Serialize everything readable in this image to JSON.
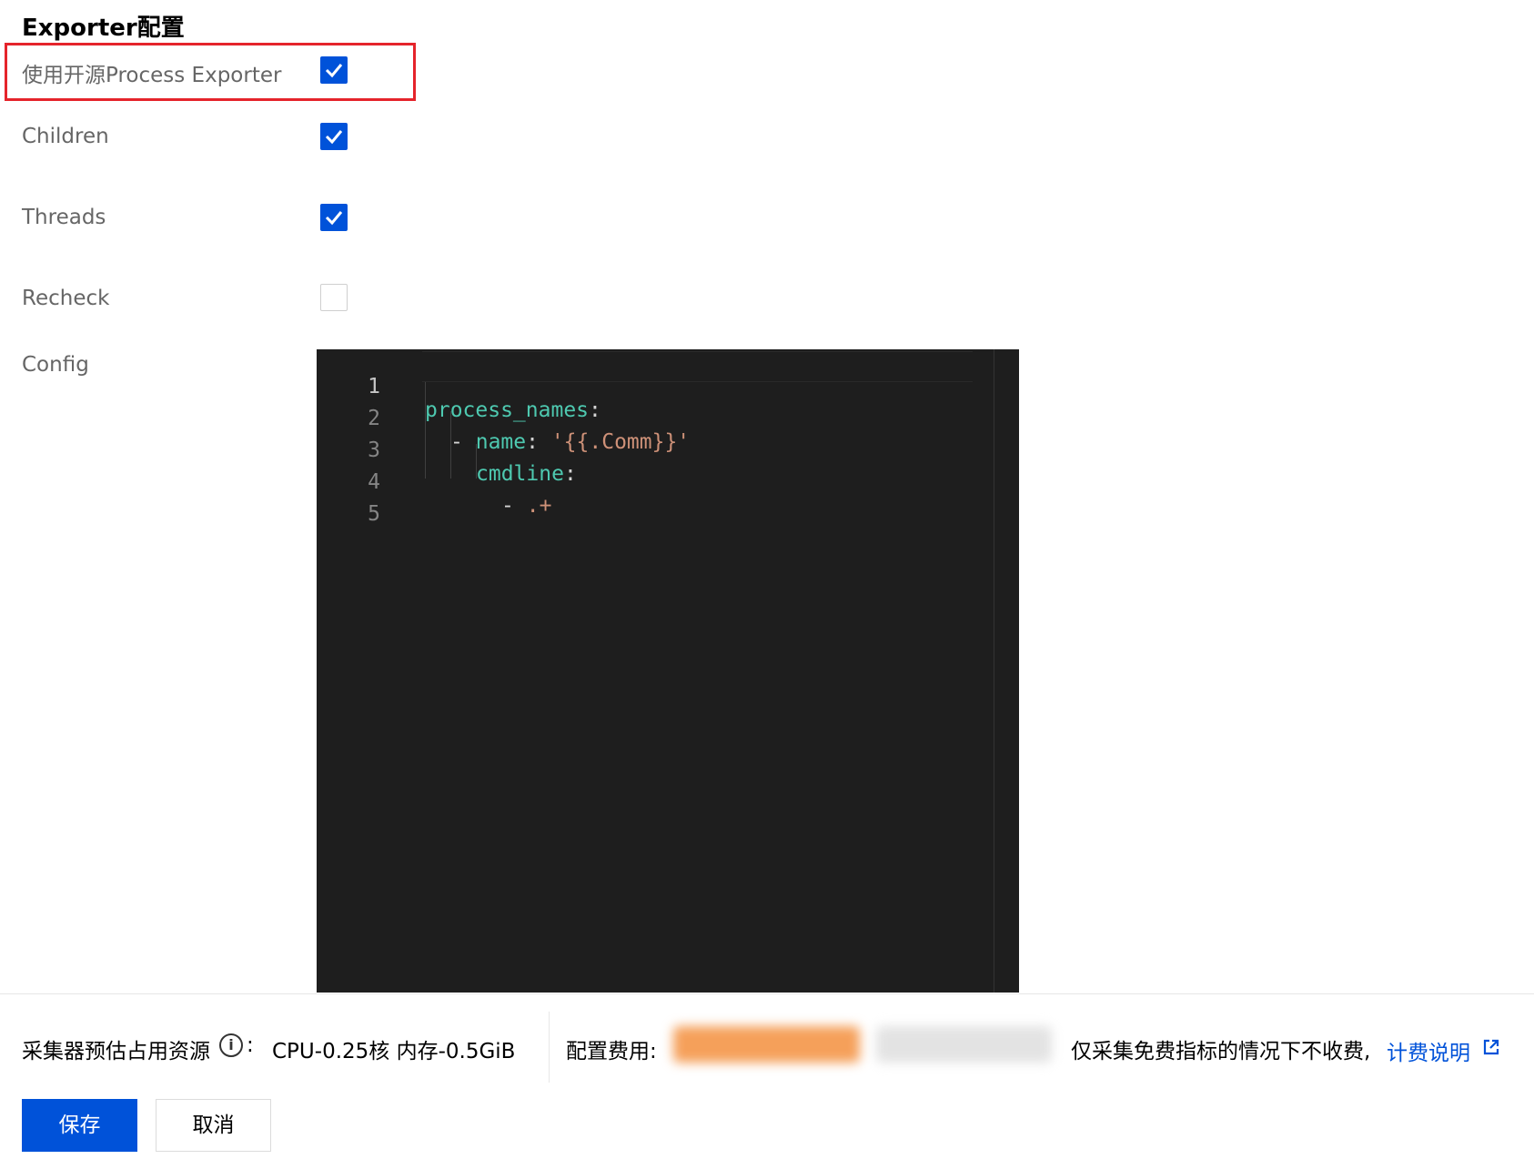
{
  "section": {
    "title": "Exporter配置"
  },
  "options": [
    {
      "label": "使用开源Process Exporter",
      "checked": true
    },
    {
      "label": "Children",
      "checked": true
    },
    {
      "label": "Threads",
      "checked": true
    },
    {
      "label": "Recheck",
      "checked": false
    }
  ],
  "config": {
    "label": "Config",
    "line_numbers": [
      "1",
      "2",
      "3",
      "4",
      "5"
    ],
    "lines": [
      {
        "key": "process_names",
        "colon": ":"
      },
      {
        "dash": "-",
        "key": "name",
        "colon": ":",
        "value": "'{{.Comm}}'"
      },
      {
        "key": "cmdline",
        "colon": ":"
      },
      {
        "dash": "-",
        "value": ".+"
      },
      {}
    ]
  },
  "footer": {
    "resource_label": "采集器预估占用资源",
    "info_icon": "i",
    "colon": ":",
    "resource_value": "CPU-0.25核 内存-0.5GiB",
    "cost_label": "配置费用:",
    "cost_note": "仅采集免费指标的情况下不收费,",
    "billing_link": "计费说明"
  },
  "buttons": {
    "save": "保存",
    "cancel": "取消"
  },
  "colors": {
    "primary": "#0052d9",
    "highlight_border": "#e5242b",
    "editor_bg": "#1e1e1e",
    "key": "#4ec9b0",
    "string": "#ce9178"
  }
}
